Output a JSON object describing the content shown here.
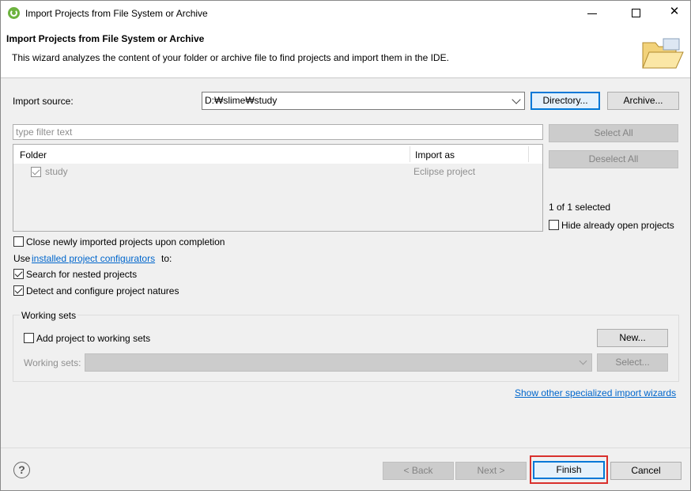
{
  "window": {
    "title": "Import Projects from File System or Archive",
    "close_glyph": "✕",
    "maximize_glyph": "☐",
    "minimize_glyph": "—"
  },
  "banner": {
    "title": "Import Projects from File System or Archive",
    "description": "This wizard analyzes the content of your folder or archive file to find projects and import them in the IDE."
  },
  "import_source": {
    "label": "Import source:",
    "value": "D:₩slime₩study",
    "directory_button": "Directory...",
    "archive_button": "Archive..."
  },
  "filter": {
    "placeholder": "type filter text"
  },
  "select_all_button": "Select All",
  "deselect_all_button": "Deselect All",
  "table": {
    "headers": [
      "Folder",
      "Import as"
    ],
    "rows": [
      {
        "folder": "study",
        "import_as": "Eclipse project",
        "checked": true
      }
    ]
  },
  "selection_count": "1 of 1 selected",
  "hide_open_label": "Hide already open projects",
  "close_imported_label": "Close newly imported projects upon completion",
  "use_prefix": "Use",
  "configurators_link": "installed project configurators",
  "use_suffix": "to:",
  "search_nested_label": "Search for nested projects",
  "detect_natures_label": "Detect and configure project natures",
  "working_sets": {
    "group_label": "Working sets",
    "add_label": "Add project to working sets",
    "new_button": "New...",
    "sets_label": "Working sets:",
    "select_button": "Select..."
  },
  "specialized_link": "Show other specialized import wizards",
  "footer": {
    "help_glyph": "?",
    "back_button": "< Back",
    "next_button": "Next >",
    "finish_button": "Finish",
    "cancel_button": "Cancel"
  },
  "colors": {
    "accent": "#0078d7",
    "link": "#0066cc",
    "highlight_box": "#d9302c"
  }
}
